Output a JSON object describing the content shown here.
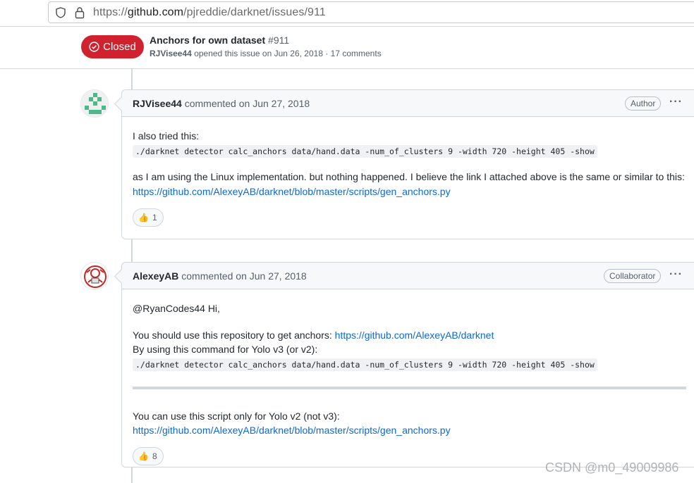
{
  "browser": {
    "url_prefix": "https://",
    "url_host": "github.com",
    "url_path": "/pjreddie/darknet/issues/911",
    "shield_icon": "shield-icon",
    "lock_icon": "lock-icon"
  },
  "issue": {
    "state": "Closed",
    "title": "Anchors for own dataset",
    "number": "#911",
    "author": "RJVisee44",
    "meta": "opened this issue on Jun 26, 2018 · 17 comments",
    "state_color": "#cf222e"
  },
  "comments": [
    {
      "author": "RJVisee44",
      "action": "commented on Jun 27, 2018",
      "role": "Author",
      "text1": "I also tried this:",
      "code1": "./darknet detector calc_anchors data/hand.data -num_of_clusters 9 -width 720 -height 405 -show",
      "text2": "as I am using the Linux implementation. but nothing happened. I believe the link I attached above is the same or similar to this:",
      "link1": "https://github.com/AlexeyAB/darknet/blob/master/scripts/gen_anchors.py",
      "reaction_emoji": "👍",
      "reaction_count": "1"
    },
    {
      "author": "AlexeyAB",
      "action": "commented on Jun 27, 2018",
      "role": "Collaborator",
      "text1": "@RyanCodes44 Hi,",
      "text2_prefix": "You should use this repository to get anchors: ",
      "link_repo": "https://github.com/AlexeyAB/darknet",
      "text3": "By using this command for Yolo v3 (or v2):",
      "code1": "./darknet detector calc_anchors data/hand.data -num_of_clusters 9 -width 720 -height 405 -show",
      "text4": "You can use this script only for Yolo v2 (not v3):",
      "link2": "https://github.com/AlexeyAB/darknet/blob/master/scripts/gen_anchors.py",
      "reaction_emoji": "👍",
      "reaction_count": "8"
    }
  ],
  "more_menu": "···",
  "watermark": "CSDN @m0_49009986"
}
